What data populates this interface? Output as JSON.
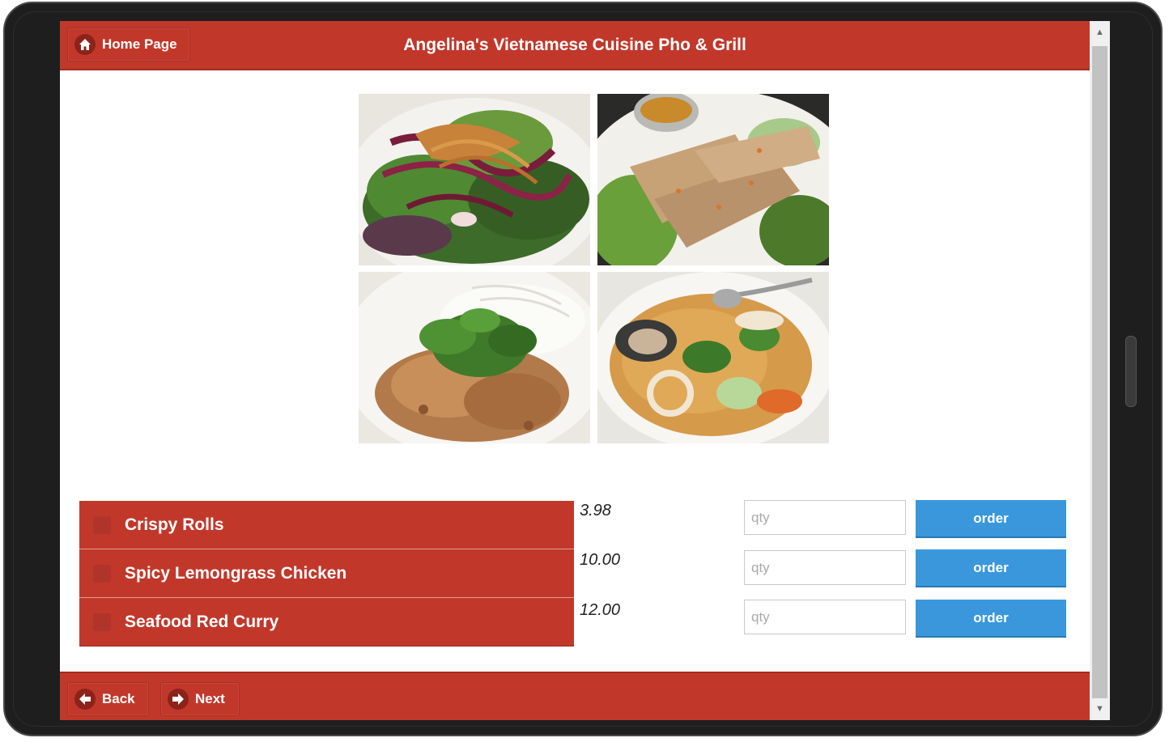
{
  "header": {
    "home_label": "Home Page",
    "title": "Angelina's Vietnamese Cuisine Pho & Grill"
  },
  "photos": [
    {
      "icon": "salad-photo"
    },
    {
      "icon": "crispy-rolls-photo"
    },
    {
      "icon": "lemongrass-chicken-photo"
    },
    {
      "icon": "seafood-curry-photo"
    }
  ],
  "menu": {
    "items": [
      {
        "name": "Crispy Rolls",
        "price": "3.98",
        "qty_placeholder": "qty",
        "order_label": "order"
      },
      {
        "name": "Spicy Lemongrass Chicken",
        "price": "10.00",
        "qty_placeholder": "qty",
        "order_label": "order"
      },
      {
        "name": "Seafood Red Curry",
        "price": "12.00",
        "qty_placeholder": "qty",
        "order_label": "order"
      }
    ]
  },
  "footer": {
    "back_label": "Back",
    "next_label": "Next"
  },
  "colors": {
    "brand_red": "#c1382b",
    "order_blue": "#3a97dc"
  },
  "icons": {
    "home": "home-icon",
    "back": "arrow-left-icon",
    "next": "arrow-right-icon"
  }
}
